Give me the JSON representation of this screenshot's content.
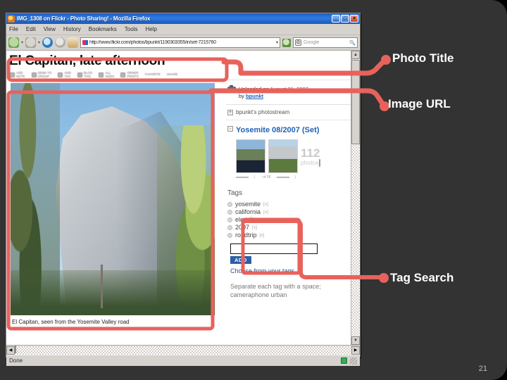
{
  "slide": {
    "page_number": "21",
    "accent_color": "#e8625c",
    "background_color": "#333334",
    "annotations": [
      {
        "id": "photo-title",
        "label": "Photo Title"
      },
      {
        "id": "image-url",
        "label": "Image URL"
      },
      {
        "id": "tag-search",
        "label": "Tag Search"
      }
    ]
  },
  "browser": {
    "window_title": "IMG_1308 on Flickr - Photo Sharing! - Mozilla Firefox",
    "window_buttons": {
      "minimize": "_",
      "maximize": "□",
      "close": "×"
    },
    "menu": [
      "File",
      "Edit",
      "View",
      "History",
      "Bookmarks",
      "Tools",
      "Help"
    ],
    "url": "http://www.flickr.com/photos/bpunkt/1190303355/in/set-7215760",
    "search_placeholder": "Google",
    "status": "Done"
  },
  "page": {
    "photo_title": "El Capitan, late afternoon",
    "actions": [
      "ADD\nNOTE",
      "SEND TO\nGROUP",
      "ADD\nTAG",
      "BLOG\nTHIS",
      "ALL\nSIZES",
      "ORDER\nPRINTS",
      "FAVORITE",
      "SHARE"
    ],
    "photo_caption": "El Capitan, seen from the Yosemite Valley road",
    "upload": {
      "prefix": "Uploaded on ",
      "date": "August 21, 2007",
      "by_label": "by ",
      "user": "bpunkt"
    },
    "photostream": {
      "expander": "+",
      "label": "bpunkt's photostream"
    },
    "set": {
      "expander": "-",
      "title": "Yosemite 08/2007 (Set)",
      "photo_count": "112",
      "photo_count_label": "photos"
    },
    "tags": {
      "heading": "Tags",
      "items": [
        {
          "name": "yosemite",
          "remove": "[x]"
        },
        {
          "name": "california",
          "remove": "[x]"
        },
        {
          "name": "elcapitan",
          "remove": "[x]"
        },
        {
          "name": "2007",
          "remove": "[x]"
        },
        {
          "name": "roadtrip",
          "remove": "[x]"
        }
      ],
      "input_value": "",
      "input_placeholder": "",
      "add_button": "ADD",
      "choose_link": "Choose from your tags",
      "hint": "Separate each tag with a space; cameraphone urban"
    }
  }
}
